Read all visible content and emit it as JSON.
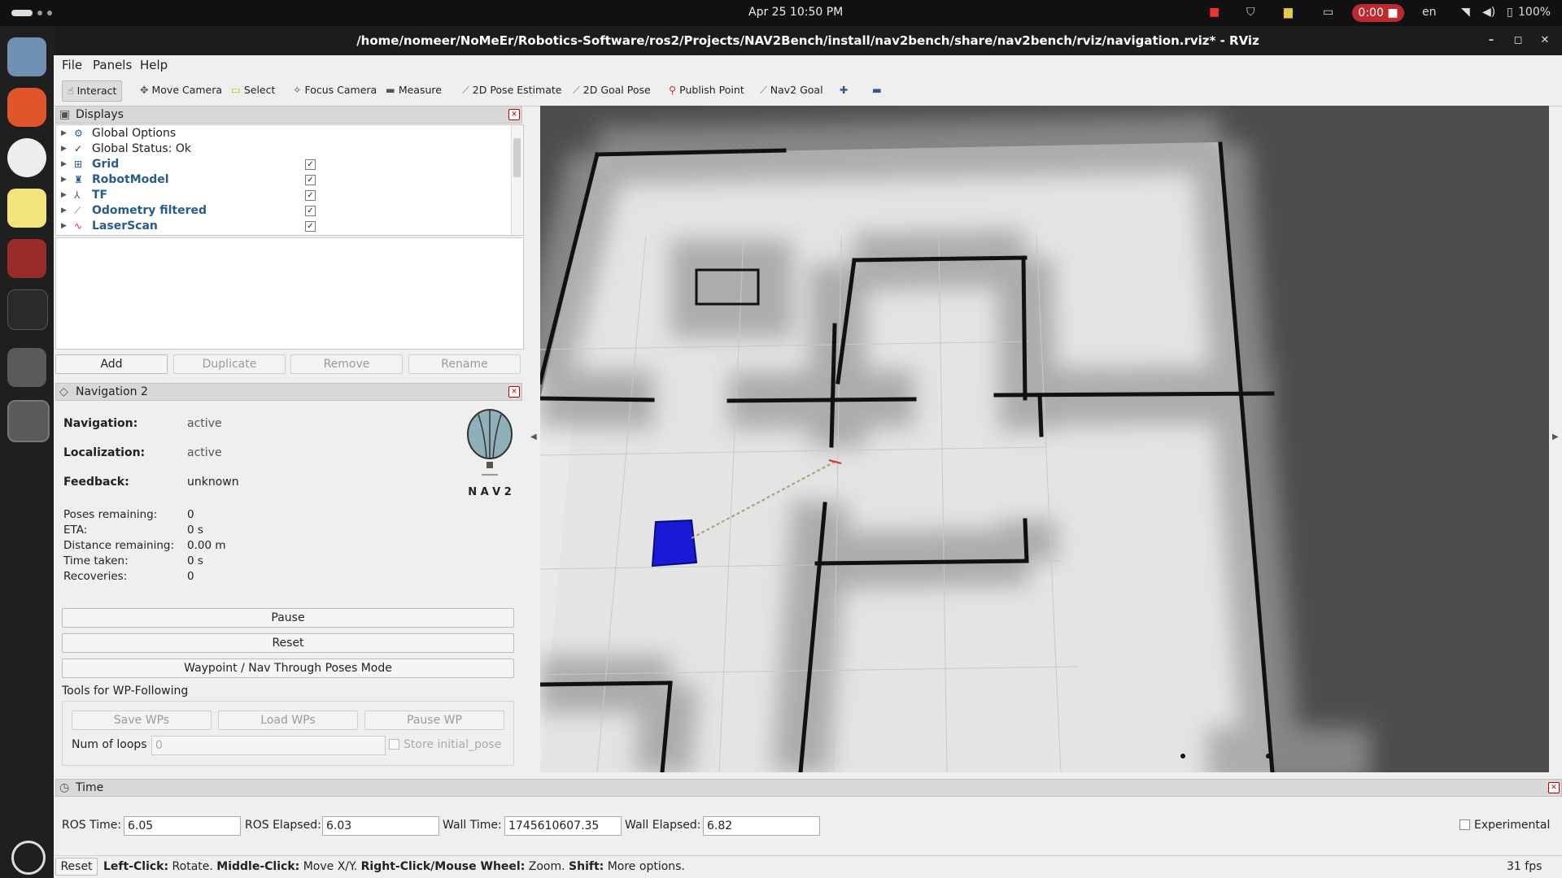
{
  "topbar": {
    "datetime": "Apr 25  10:50 PM",
    "recording": "0:00",
    "language": "en",
    "battery": "100%"
  },
  "window": {
    "title": "/home/nomeer/NoMeEr/Robotics-Software/ros2/Projects/NAV2Bench/install/nav2bench/share/nav2bench/rviz/navigation.rviz* - RViz"
  },
  "menu": [
    "File",
    "Panels",
    "Help"
  ],
  "toolbar": {
    "interact": "Interact",
    "move_camera": "Move Camera",
    "select": "Select",
    "focus_camera": "Focus Camera",
    "measure": "Measure",
    "pose_estimate": "2D Pose Estimate",
    "goal_pose": "2D Goal Pose",
    "publish_point": "Publish Point",
    "nav2_goal": "Nav2 Goal"
  },
  "displays": {
    "title": "Displays",
    "items": [
      {
        "label": "Global Options",
        "checked": null,
        "icon": "gear-icon"
      },
      {
        "label": "Global Status: Ok",
        "checked": null,
        "icon": "check-icon"
      },
      {
        "label": "Grid",
        "checked": true,
        "icon": "grid-icon"
      },
      {
        "label": "RobotModel",
        "checked": true,
        "icon": "robot-icon"
      },
      {
        "label": "TF",
        "checked": true,
        "icon": "tf-icon"
      },
      {
        "label": "Odometry filtered",
        "checked": true,
        "icon": "odometry-icon"
      },
      {
        "label": "LaserScan",
        "checked": true,
        "icon": "laserscan-icon"
      }
    ],
    "buttons": {
      "add": "Add",
      "duplicate": "Duplicate",
      "remove": "Remove",
      "rename": "Rename"
    }
  },
  "nav2": {
    "title": "Navigation 2",
    "navigation_label": "Navigation:",
    "navigation_value": "active",
    "localization_label": "Localization:",
    "localization_value": "active",
    "feedback_label": "Feedback:",
    "feedback_value": "unknown",
    "logo_text": "N A V 2",
    "poses_remaining_label": "Poses remaining:",
    "poses_remaining_value": "0",
    "eta_label": "ETA:",
    "eta_value": "0 s",
    "distance_label": "Distance remaining:",
    "distance_value": "0.00 m",
    "time_taken_label": "Time taken:",
    "time_taken_value": "0 s",
    "recoveries_label": "Recoveries:",
    "recoveries_value": "0",
    "pause": "Pause",
    "reset": "Reset",
    "waypoint_mode": "Waypoint / Nav Through Poses Mode",
    "wp_tools_label": "Tools for WP-Following",
    "save_wps": "Save WPs",
    "load_wps": "Load WPs",
    "pause_wp": "Pause WP",
    "num_loops_label": "Num of loops",
    "num_loops_value": "0",
    "store_initial_pose": "Store initial_pose"
  },
  "time": {
    "title": "Time",
    "ros_time_label": "ROS Time:",
    "ros_time": "6.05",
    "ros_elapsed_label": "ROS Elapsed:",
    "ros_elapsed": "6.03",
    "wall_time_label": "Wall Time:",
    "wall_time": "1745610607.35",
    "wall_elapsed_label": "Wall Elapsed:",
    "wall_elapsed": "6.82",
    "experimental": "Experimental"
  },
  "status": {
    "reset": "Reset",
    "hint_leftclick": "Left-Click:",
    "hint_leftclick_action": " Rotate. ",
    "hint_middleclick": "Middle-Click:",
    "hint_middleclick_action": " Move X/Y. ",
    "hint_rightclick": "Right-Click/Mouse Wheel:",
    "hint_rightclick_action": " Zoom. ",
    "hint_shift": "Shift:",
    "hint_shift_action": " More options.",
    "fps": "31 fps"
  }
}
